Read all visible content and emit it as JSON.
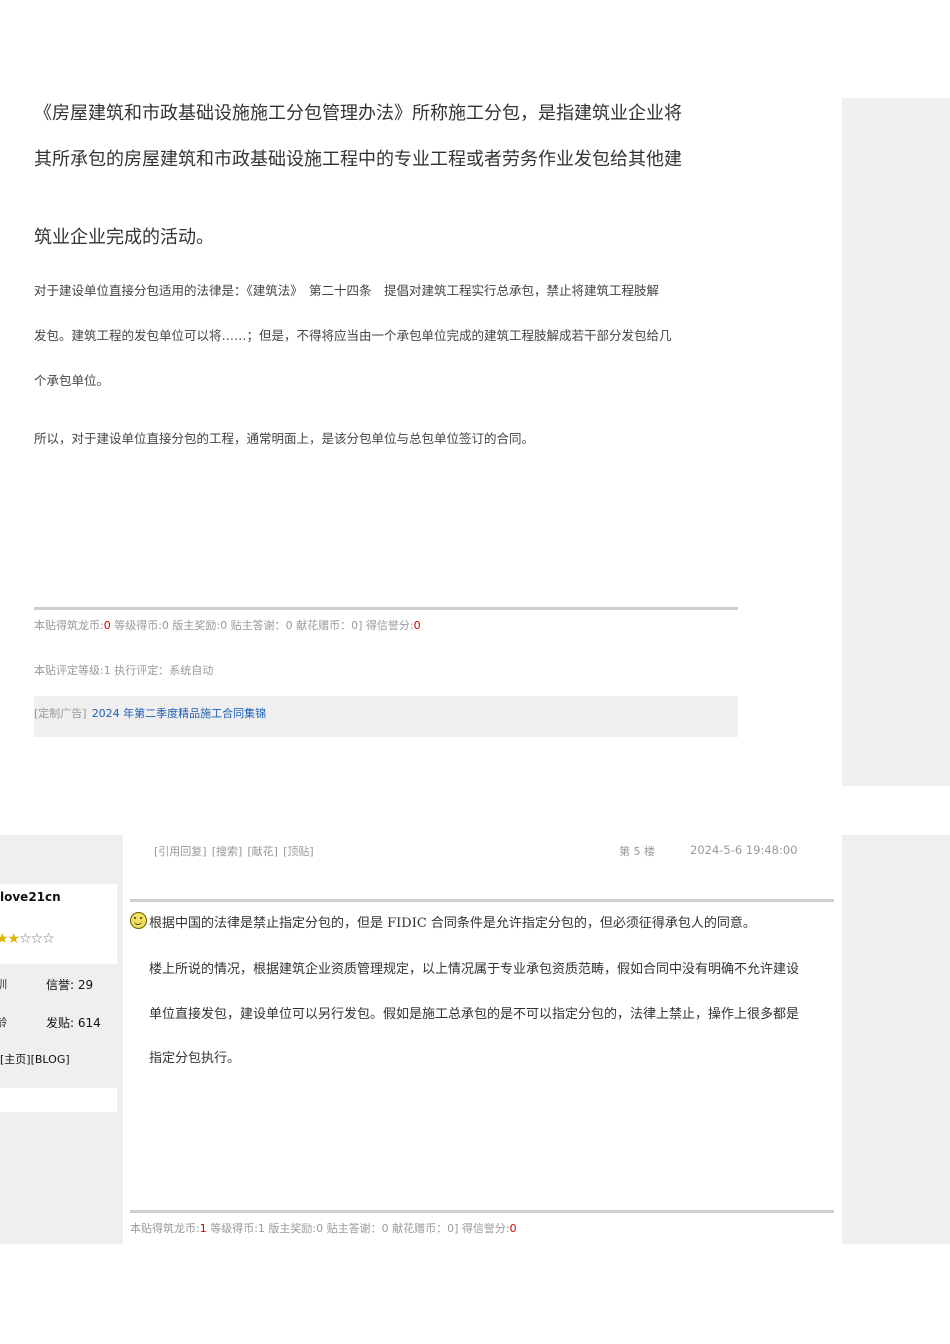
{
  "post1": {
    "lead_lines": [
      "《房屋建筑和市政基础设施施工分包管理办法》所称施工分包，是指建筑业企业将",
      "其所承包的房屋建筑和市政基础设施工程中的专业工程或者劳务作业发包给其他建",
      "筑业企业完成的活动。"
    ],
    "body_lines": [
      "对于建设单位直接分包适用的法律是：《建筑法》　第二十四条　提倡对建筑工程实行总承包，禁止将建筑工程肢解",
      "发包。建筑工程的发包单位可以将……；但是，不得将应当由一个承包单位完成的建筑工程肢解成若干部分发包给几",
      "个承包单位。"
    ],
    "conclusion": "所以，对于建设单位直接分包的工程，通常明面上，是该分包单位与总包单位签订的合同。",
    "stats": {
      "coin_label": "本贴得筑龙币:",
      "coin_value": "0",
      "rest": " 等级得币:0 版主奖励:0 贴主答谢：0 献花赠币：0] 得信誉分:",
      "credit_value": "0"
    },
    "rating": "本贴评定等级:1 执行评定：系统自动",
    "ad": {
      "tag": "[定制广告]",
      "link": "2024 年第二季度精品施工合同集锦"
    }
  },
  "post2": {
    "toolbar": {
      "quote": "[引用回复]",
      "search": "[搜索]",
      "flower": "[献花]",
      "top": "[顶贴]"
    },
    "floor": "第 5 楼",
    "datetime": "2024-5-6 19:48:00",
    "user": {
      "name": "love21cn",
      "stars_filled": "★★",
      "stars_empty": "☆☆☆",
      "left1": "训",
      "credit_label": "信誉: ",
      "credit_value": "29",
      "left2": "龄",
      "posts_label": "发贴: ",
      "posts_value": "614",
      "links": "[主页][BLOG]"
    },
    "first_line": "根据中国的法律是禁止指定分包的，但是 FIDIC 合同条件是允许指定分包的，但必须征得承包人的同意。",
    "paragraph_lines": [
      "楼上所说的情况，根据建筑企业资质管理规定，以上情况属于专业承包资质范畴，假如合同中没有明确不允许建设",
      "单位直接发包，建设单位可以另行发包。假如是施工总承包的是不可以指定分包的，法律上禁止，操作上很多都是",
      "指定分包执行。"
    ],
    "stats": {
      "coin_label": "本贴得筑龙币:",
      "coin_value": "1",
      "rest": " 等级得币:1 版主奖励:0 贴主答谢：0 献花赠币：0] 得信誉分:",
      "credit_value": "0"
    }
  }
}
